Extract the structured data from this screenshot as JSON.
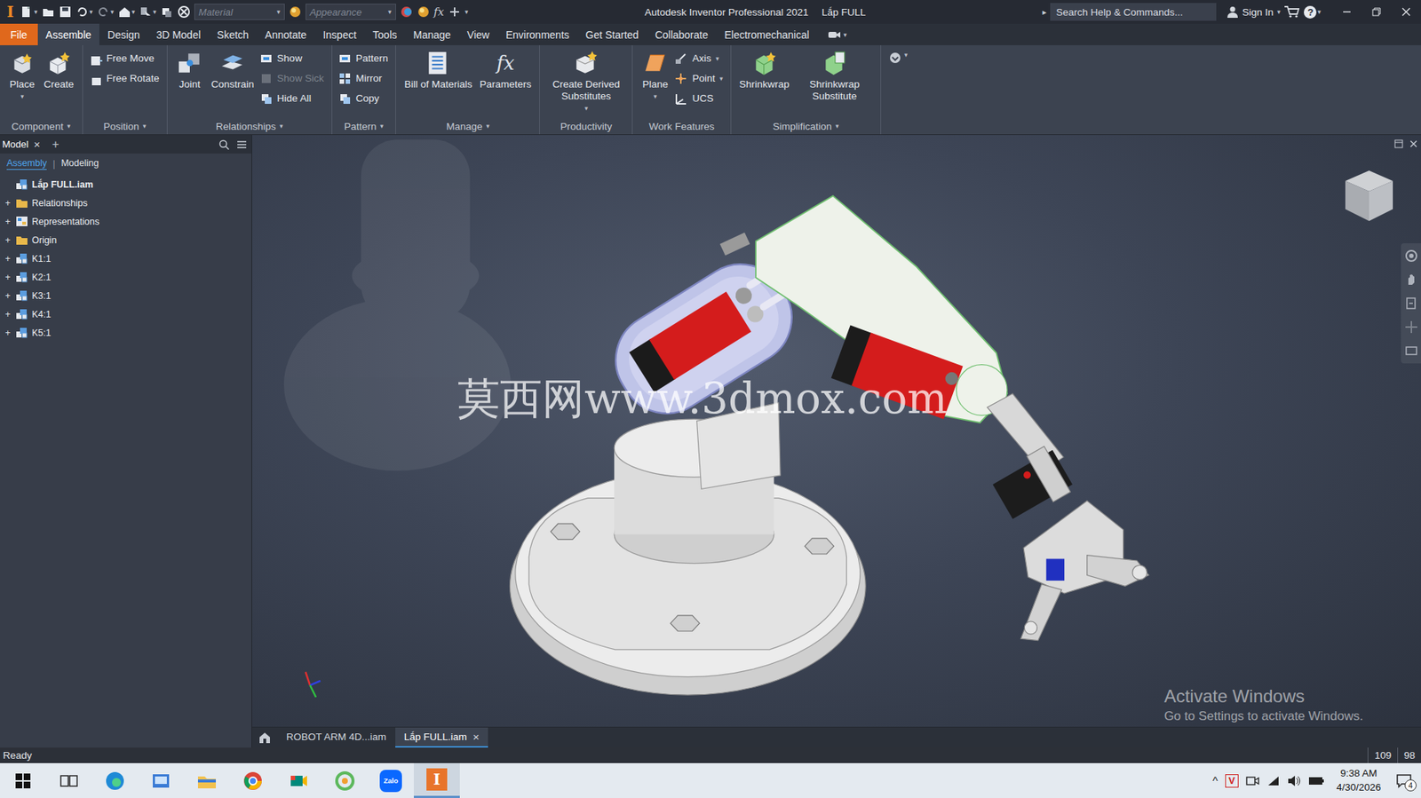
{
  "window": {
    "app_letter": "I",
    "title": "Autodesk Inventor Professional 2021",
    "document": "Lắp FULL"
  },
  "glyphs": {
    "dropdown": "▾",
    "close": "×",
    "plus": "+",
    "expand": "+",
    "more": "▸",
    "help": "?",
    "tray_up": "^",
    "separator": "|"
  },
  "quick_access": {
    "material": "Material",
    "appearance": "Appearance",
    "formula": "fx"
  },
  "search": {
    "placeholder": "Search Help & Commands..."
  },
  "account": {
    "sign_in": "Sign In"
  },
  "menu_tabs": [
    {
      "label": "File",
      "selected": false,
      "kind": "file"
    },
    {
      "label": "Assemble",
      "selected": true,
      "kind": "tab"
    },
    {
      "label": "Design",
      "selected": false,
      "kind": "tab"
    },
    {
      "label": "3D Model",
      "selected": false,
      "kind": "tab"
    },
    {
      "label": "Sketch",
      "selected": false,
      "kind": "tab"
    },
    {
      "label": "Annotate",
      "selected": false,
      "kind": "tab"
    },
    {
      "label": "Inspect",
      "selected": false,
      "kind": "tab"
    },
    {
      "label": "Tools",
      "selected": false,
      "kind": "tab"
    },
    {
      "label": "Manage",
      "selected": false,
      "kind": "tab"
    },
    {
      "label": "View",
      "selected": false,
      "kind": "tab"
    },
    {
      "label": "Environments",
      "selected": false,
      "kind": "tab"
    },
    {
      "label": "Get Started",
      "selected": false,
      "kind": "tab"
    },
    {
      "label": "Collaborate",
      "selected": false,
      "kind": "tab"
    },
    {
      "label": "Electromechanical",
      "selected": false,
      "kind": "tab"
    }
  ],
  "ribbon_panels": [
    {
      "title": "Component",
      "dropdown": true,
      "tools": [
        {
          "label": "Place",
          "kind": "large",
          "dropdown": true,
          "disabled": false
        },
        {
          "label": "Create",
          "kind": "large",
          "dropdown": false,
          "disabled": false
        }
      ]
    },
    {
      "title": "Position",
      "dropdown": true,
      "tools": [
        {
          "label": "Free Move",
          "kind": "small",
          "dropdown": false,
          "disabled": false
        },
        {
          "label": "Free Rotate",
          "kind": "small",
          "dropdown": false,
          "disabled": false
        }
      ]
    },
    {
      "title": "Relationships",
      "dropdown": true,
      "tools": [
        {
          "label": "Joint",
          "kind": "large",
          "dropdown": false,
          "disabled": false
        },
        {
          "label": "Constrain",
          "kind": "large",
          "dropdown": false,
          "disabled": false
        },
        {
          "label": "Show",
          "kind": "small",
          "dropdown": false,
          "disabled": false
        },
        {
          "label": "Show Sick",
          "kind": "small",
          "dropdown": false,
          "disabled": true
        },
        {
          "label": "Hide All",
          "kind": "small",
          "dropdown": false,
          "disabled": false
        }
      ]
    },
    {
      "title": "Pattern",
      "dropdown": true,
      "tools": [
        {
          "label": "Pattern",
          "kind": "small",
          "dropdown": false,
          "disabled": false
        },
        {
          "label": "Mirror",
          "kind": "small",
          "dropdown": false,
          "disabled": false
        },
        {
          "label": "Copy",
          "kind": "small",
          "dropdown": false,
          "disabled": false
        }
      ]
    },
    {
      "title": "Manage",
      "dropdown": true,
      "tools": [
        {
          "label": "Bill of Materials",
          "kind": "large",
          "dropdown": false,
          "disabled": false
        },
        {
          "label": "Parameters",
          "kind": "large",
          "dropdown": false,
          "disabled": false
        }
      ]
    },
    {
      "title": "Productivity",
      "dropdown": false,
      "tools": [
        {
          "label": "Create Derived Substitutes",
          "kind": "large",
          "dropdown": true,
          "disabled": false
        }
      ]
    },
    {
      "title": "Work Features",
      "dropdown": false,
      "tools": [
        {
          "label": "Plane",
          "kind": "large",
          "dropdown": true,
          "disabled": false
        },
        {
          "label": "Axis",
          "kind": "small",
          "dropdown": true,
          "disabled": false
        },
        {
          "label": "Point",
          "kind": "small",
          "dropdown": true,
          "disabled": false
        },
        {
          "label": "UCS",
          "kind": "small",
          "dropdown": false,
          "disabled": false
        }
      ]
    },
    {
      "title": "Simplification",
      "dropdown": true,
      "tools": [
        {
          "label": "Shrinkwrap",
          "kind": "large",
          "dropdown": false,
          "disabled": false
        },
        {
          "label": "Shrinkwrap Substitute",
          "kind": "large",
          "dropdown": false,
          "disabled": false
        }
      ]
    }
  ],
  "browser": {
    "tabs": [
      {
        "label": "Model",
        "selected": true,
        "closable": true
      }
    ],
    "subtabs": [
      {
        "label": "Assembly",
        "selected": true
      },
      {
        "label": "Modeling",
        "selected": false
      }
    ],
    "tree": [
      {
        "label": "Lắp FULL.iam",
        "kind": "assembly",
        "expandable": false,
        "expanded": true,
        "root": true
      },
      {
        "label": "Relationships",
        "kind": "folder",
        "expandable": true,
        "expanded": false,
        "root": false
      },
      {
        "label": "Representations",
        "kind": "representations",
        "expandable": true,
        "expanded": false,
        "root": false
      },
      {
        "label": "Origin",
        "kind": "folder",
        "expandable": true,
        "expanded": false,
        "root": false
      },
      {
        "label": "K1:1",
        "kind": "part",
        "expandable": true,
        "expanded": false,
        "root": false
      },
      {
        "label": "K2:1",
        "kind": "part",
        "expandable": true,
        "expanded": false,
        "root": false
      },
      {
        "label": "K3:1",
        "kind": "part",
        "expandable": true,
        "expanded": false,
        "root": false
      },
      {
        "label": "K4:1",
        "kind": "part",
        "expandable": true,
        "expanded": false,
        "root": false
      },
      {
        "label": "K5:1",
        "kind": "part",
        "expandable": true,
        "expanded": false,
        "root": false
      }
    ]
  },
  "viewport": {
    "watermark": "莫西网www.3dmox.com"
  },
  "activation": {
    "title": "Activate Windows",
    "subtitle": "Go to Settings to activate Windows."
  },
  "document_tabs": [
    {
      "label": "ROBOT ARM 4D...iam",
      "selected": false,
      "closable": false
    },
    {
      "label": "Lắp FULL.iam",
      "selected": true,
      "closable": true
    }
  ],
  "status_bar": {
    "text": "Ready",
    "cells": [
      "109",
      "98"
    ]
  },
  "taskbar": {
    "apps": [
      {
        "label": "",
        "active": false
      },
      {
        "label": "",
        "active": false
      },
      {
        "label": "",
        "active": false
      },
      {
        "label": "",
        "active": false
      },
      {
        "label": "",
        "active": false
      },
      {
        "label": "",
        "active": false
      },
      {
        "label": "",
        "active": false
      },
      {
        "label": "Zalo",
        "active": false
      },
      {
        "label": "",
        "active": true
      }
    ],
    "ime": "V",
    "time": "9:38 AM",
    "date": "4/30/2026",
    "notifications": "4"
  }
}
